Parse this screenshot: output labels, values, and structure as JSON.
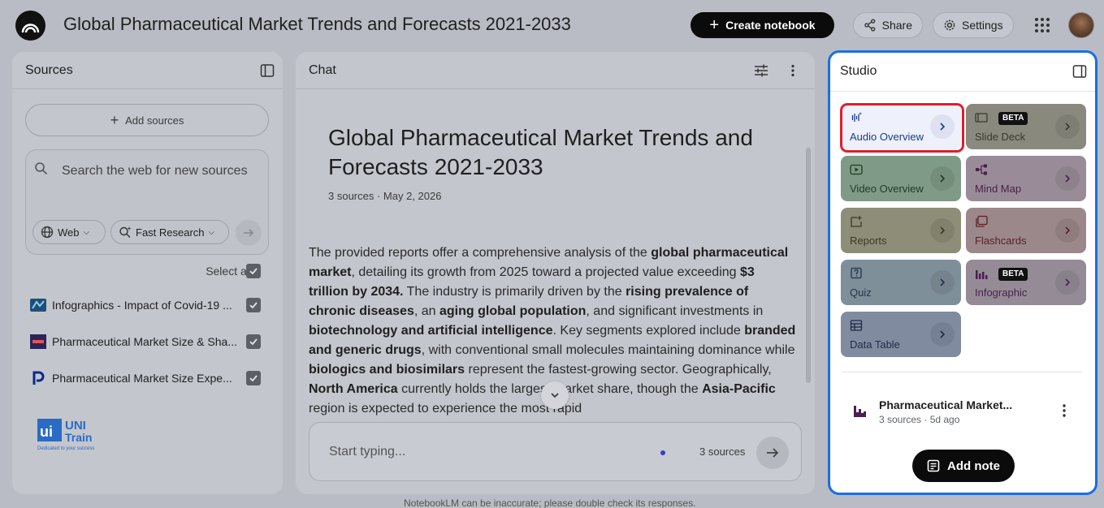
{
  "app": {
    "title": "Global Pharmaceutical Market Trends and Forecasts 2021-2033",
    "create_label": "Create notebook",
    "share_label": "Share",
    "settings_label": "Settings"
  },
  "sources": {
    "title": "Sources",
    "add_label": "Add sources",
    "search_placeholder": "Search the web for new sources",
    "chip_web": "Web",
    "chip_research": "Fast Research",
    "select_all": "Select all",
    "items": [
      {
        "label": "Infographics - Impact of Covid-19 ...",
        "icon": "infographic-source-icon"
      },
      {
        "label": "Pharmaceutical Market Size & Sha...",
        "icon": "report-source-icon"
      },
      {
        "label": "Pharmaceutical Market Size Expe...",
        "icon": "p-logo-icon"
      }
    ],
    "logo_text": "UNI Train",
    "logo_tagline": "Dedicated to your success"
  },
  "chat": {
    "title": "Chat",
    "heading": "Global Pharmaceutical Market Trends and Forecasts 2021-2033",
    "meta": "3 sources · May 2, 2026",
    "input_placeholder": "Start typing...",
    "input_sources": "3 sources",
    "body_parts": [
      {
        "t": "The provided reports offer a comprehensive analysis of the ",
        "b": false
      },
      {
        "t": "global pharmaceutical market",
        "b": true
      },
      {
        "t": ", detailing its growth from 2025 toward a projected value exceeding ",
        "b": false
      },
      {
        "t": "$3 trillion by 2034.",
        "b": true
      },
      {
        "t": " The industry is primarily driven by the ",
        "b": false
      },
      {
        "t": "rising prevalence of chronic diseases",
        "b": true
      },
      {
        "t": ", an ",
        "b": false
      },
      {
        "t": "aging global population",
        "b": true
      },
      {
        "t": ", and significant investments in ",
        "b": false
      },
      {
        "t": "biotechnology and artificial intelligence",
        "b": true
      },
      {
        "t": ". Key segments explored include ",
        "b": false
      },
      {
        "t": "branded and generic drugs",
        "b": true
      },
      {
        "t": ", with conventional small molecules maintaining dominance while ",
        "b": false
      },
      {
        "t": "biologics and biosimilars",
        "b": true
      },
      {
        "t": " represent the fastest-growing sector. Geographically, ",
        "b": false
      },
      {
        "t": "North America",
        "b": true
      },
      {
        "t": " currently holds the largest market share, though the ",
        "b": false
      },
      {
        "t": "Asia-Pacific",
        "b": true
      },
      {
        "t": " region is expected to experience the most rapid",
        "b": false
      }
    ]
  },
  "studio": {
    "title": "Studio",
    "tiles": [
      {
        "label": "Audio Overview",
        "icon": "audio-waveform-icon",
        "beta": "",
        "bg": "#eef0fb",
        "fg": "#1a3b8f"
      },
      {
        "label": "Slide Deck",
        "icon": "slides-icon",
        "beta": "BETA",
        "bg": "#8a897e",
        "fg": "#3c3a2e"
      },
      {
        "label": "Video Overview",
        "icon": "video-icon",
        "beta": "",
        "bg": "#7f9a86",
        "fg": "#1f3c24"
      },
      {
        "label": "Mind Map",
        "icon": "mind-map-icon",
        "beta": "",
        "bg": "#998c98",
        "fg": "#4a1f48"
      },
      {
        "label": "Reports",
        "icon": "reports-icon",
        "beta": "",
        "bg": "#8e8d77",
        "fg": "#3c3a24"
      },
      {
        "label": "Flashcards",
        "icon": "flashcards-icon",
        "beta": "",
        "bg": "#9b888a",
        "fg": "#5a1f28"
      },
      {
        "label": "Quiz",
        "icon": "quiz-icon",
        "beta": "",
        "bg": "#7f8f9a",
        "fg": "#1f3447"
      },
      {
        "label": "Infographic",
        "icon": "infographic-icon",
        "beta": "BETA",
        "bg": "#948b96",
        "fg": "#4a1f52"
      },
      {
        "label": "Data Table",
        "icon": "data-table-icon",
        "beta": "",
        "bg": "#818ba0",
        "fg": "#1f2c47"
      }
    ],
    "note_title": "Pharmaceutical Market...",
    "note_meta": "3 sources · 5d ago",
    "add_note_label": "Add note"
  },
  "footer": "NotebookLM can be inaccurate; please double check its responses.",
  "colors": {
    "accent_border": "#1a6ee6",
    "highlight": "#e01e2b"
  }
}
